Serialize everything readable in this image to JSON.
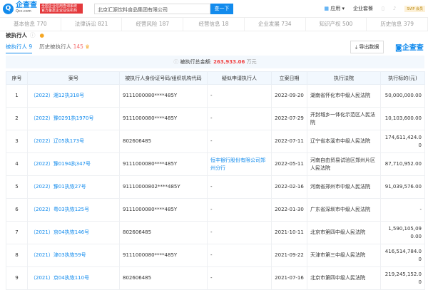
{
  "header": {
    "logo": "企查查",
    "logo_sub": "Qcc.com",
    "badge": "全国企业信用查询系统 官方备案企业征信机构",
    "search_value": "北京汇源饮料食品集团有限公司",
    "search_button": "查一下",
    "apps": "应用",
    "package": "企业套餐",
    "vip": "SVIP 会员"
  },
  "tabs": [
    {
      "label": "基本信息",
      "count": "770"
    },
    {
      "label": "法律诉讼",
      "count": "821"
    },
    {
      "label": "经营风险",
      "count": "187"
    },
    {
      "label": "经营信息",
      "count": "18"
    },
    {
      "label": "企业发展",
      "count": "734"
    },
    {
      "label": "知识产权",
      "count": "500"
    },
    {
      "label": "历史信息",
      "count": "379"
    }
  ],
  "section": {
    "title": "被执行人",
    "sub_active": "被执行人",
    "sub_active_count": "9",
    "sub_hist": "历史被执行人",
    "sub_hist_count": "145",
    "export": "导出数据",
    "watermark": "企查查"
  },
  "summary": {
    "label": "被执行总金额:",
    "amount": "263,933.06",
    "unit": "万元"
  },
  "columns": [
    "序号",
    "案号",
    "被执行人身份证号码/组织机构代码",
    "疑似申请执行人",
    "立案日期",
    "执行法院",
    "执行标的(元)"
  ],
  "rows": [
    [
      "1",
      "（2022）湘12执318号",
      "9111000080****485Y",
      "-",
      "2022-09-20",
      "湖南省怀化市中级人民法院",
      "50,000,000.00"
    ],
    [
      "2",
      "（2022）豫0291执1970号",
      "9111000080****485Y",
      "-",
      "2022-07-29",
      "开封城乡一体化示范区人民法院",
      "10,103,600.00"
    ],
    [
      "3",
      "（2022）辽05执173号",
      "802606485",
      "-",
      "2022-07-11",
      "辽宁省本溪市中级人民法院",
      "174,611,424.00"
    ],
    [
      "4",
      "（2022）豫0194执347号",
      "9111000080****485Y",
      "恒丰银行股份有限公司郑州分行",
      "2022-05-11",
      "河南自由贸易试验区郑州片区人民法院",
      "87,710,952.00"
    ],
    [
      "5",
      "（2022）豫01执恢27号",
      "91110000802****485Y",
      "-",
      "2022-02-16",
      "河南省郑州市中级人民法院",
      "91,039,576.00"
    ],
    [
      "6",
      "（2022）粤03执恢125号",
      "9111000080****485Y",
      "-",
      "2022-01-30",
      "广东省深圳市中级人民法院",
      "-"
    ],
    [
      "7",
      "（2021）京04执恢146号",
      "802606485",
      "-",
      "2021-10-11",
      "北京市第四中级人民法院",
      "1,590,105,090.00"
    ],
    [
      "8",
      "（2021）津03执恢59号",
      "9111000080****485Y",
      "-",
      "2021-09-22",
      "天津市第三中级人民法院",
      "416,514,784.00"
    ],
    [
      "9",
      "（2021）京04执恢110号",
      "802606485",
      "-",
      "2021-07-16",
      "北京市第四中级人民法院",
      "219,245,152.00"
    ]
  ]
}
